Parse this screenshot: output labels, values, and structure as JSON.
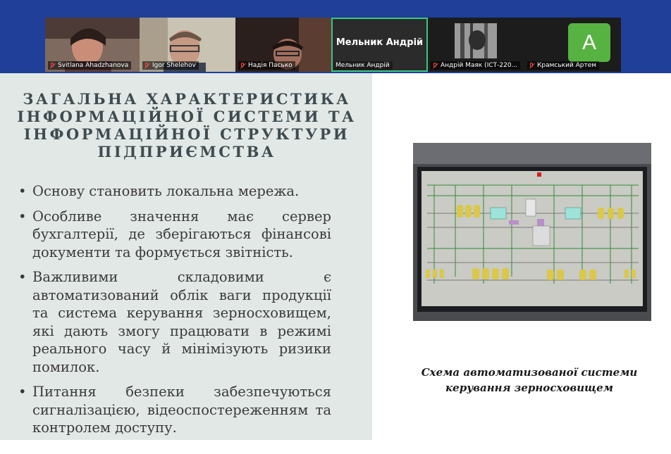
{
  "meeting": {
    "participants": [
      {
        "name": "Svitlana Ahadzhanova",
        "muted": true
      },
      {
        "name": "Igor Shelehov",
        "muted": true
      },
      {
        "name": "Надія Пасько",
        "muted": true
      },
      {
        "name": "Мельник Андрій",
        "muted": false,
        "active_speaker": true,
        "display_name": "Мельник Андрій"
      },
      {
        "name": "Андрій Маяк (ІСТ-220...",
        "muted": true
      },
      {
        "name": "Крамський Артем",
        "muted": true,
        "avatar_letter": "A"
      }
    ],
    "active_color": "#38c77f"
  },
  "slide": {
    "title": "ЗАГАЛЬНА ХАРАКТЕРИСТИКА ІНФОРМАЦІЙНОЇ СИСТЕМИ ТА ІНФОРМАЦІЙНОЇ СТРУКТУРИ ПІДПРИЄМСТВА",
    "bullet_symbol": "•",
    "bullets": [
      "Основу становить локальна мережа.",
      "Особливе значення має сервер бухгалтерії, де зберігаються фінансові документи та формується звітність.",
      "Важливими складовими є автоматизований облік ваги продукції та система керування зерносховищем, які дають змогу працювати в режимі реального часу й мінімізують ризики помилок.",
      "Питання безпеки забезпечуються сигналізацією, відеоспостереженням та контролем доступу."
    ],
    "image_caption": "Схема автоматизованої системи керування зерносховищем"
  }
}
